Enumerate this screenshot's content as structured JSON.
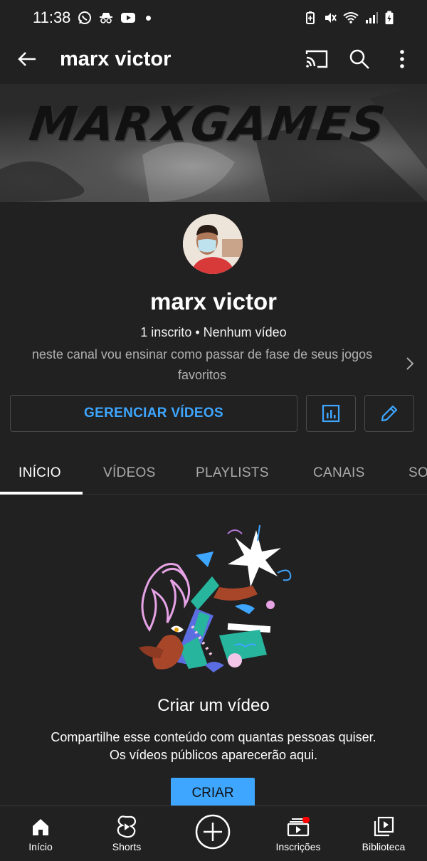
{
  "status_bar": {
    "time": "11:38",
    "left_icons": [
      "whatsapp-icon",
      "incognito-icon",
      "youtube-icon",
      "notification-dot"
    ],
    "right_icons": [
      "battery-saver-icon",
      "mute-icon",
      "wifi-icon",
      "signal-icon",
      "battery-icon"
    ]
  },
  "app_bar": {
    "title": "marx victor",
    "icons": [
      "back-arrow-icon",
      "cast-icon",
      "search-icon",
      "more-vert-icon"
    ]
  },
  "banner": {
    "text": "MARXGAMES"
  },
  "channel": {
    "name": "marx victor",
    "stats": "1 inscrito • Nenhum vídeo",
    "description": "neste canal vou ensinar como passar de fase de seus jogos favoritos"
  },
  "actions": {
    "manage_label": "GERENCIAR VÍDEOS",
    "icons": [
      "analytics-icon",
      "edit-pencil-icon"
    ]
  },
  "tabs": [
    {
      "label": "INÍCIO",
      "active": true
    },
    {
      "label": "VÍDEOS",
      "active": false
    },
    {
      "label": "PLAYLISTS",
      "active": false
    },
    {
      "label": "CANAIS",
      "active": false
    },
    {
      "label": "SO",
      "active": false
    }
  ],
  "empty_state": {
    "title": "Criar um vídeo",
    "subtitle_line1": "Compartilhe esse conteúdo com quantas pessoas quiser.",
    "subtitle_line2": "Os vídeos públicos aparecerão aqui.",
    "button_label": "CRIAR"
  },
  "bottom_nav": [
    {
      "label": "Início",
      "icon": "home-icon"
    },
    {
      "label": "Shorts",
      "icon": "shorts-icon"
    },
    {
      "label": "",
      "icon": "create-plus-icon"
    },
    {
      "label": "Inscrições",
      "icon": "subscriptions-icon"
    },
    {
      "label": "Biblioteca",
      "icon": "library-icon"
    }
  ],
  "colors": {
    "background": "#212121",
    "accent_blue": "#3ea6ff",
    "notification_red": "#ff0000"
  }
}
